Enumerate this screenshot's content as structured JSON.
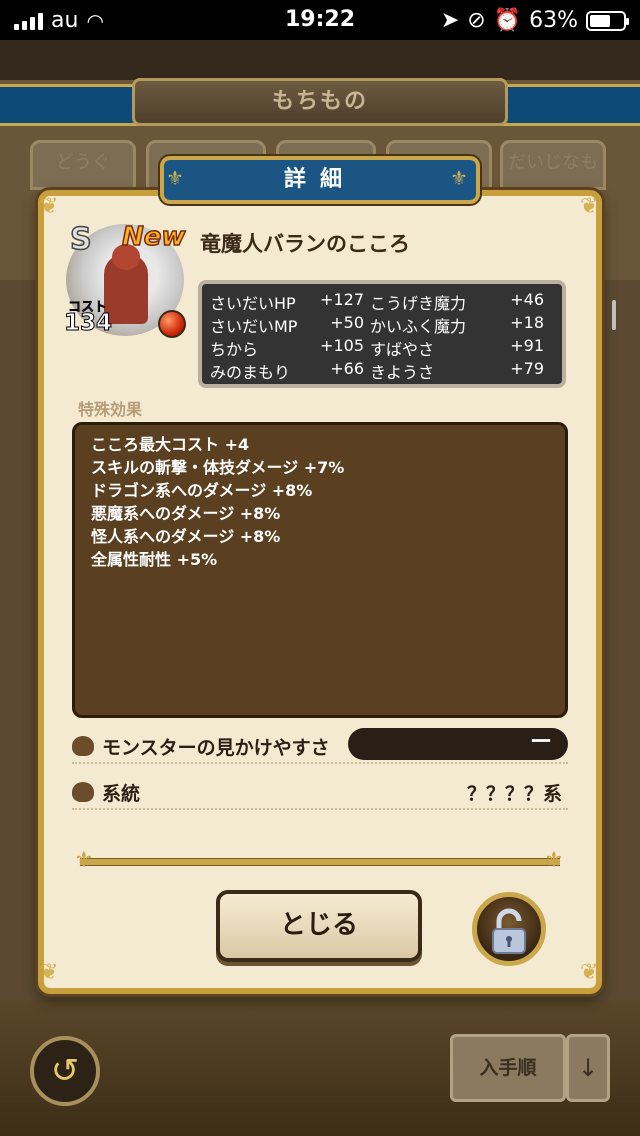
{
  "status_bar": {
    "carrier": "au",
    "time": "19:22",
    "battery": "63%",
    "battery_level": 0.63
  },
  "background": {
    "title": "もちもの",
    "tabs": [
      "どうぐ",
      "",
      "",
      "",
      "だいじなもの"
    ],
    "sort_label": "入手順",
    "sort_arrow": "↓",
    "back_icon": "↺"
  },
  "dialog": {
    "header": "詳細",
    "rank": "S",
    "new_badge": "New",
    "cost_label": "コスト",
    "cost_value": "134",
    "name": "竜魔人バランのこころ",
    "stats": [
      {
        "label": "さいだいHP",
        "value": "+127"
      },
      {
        "label": "こうげき魔力",
        "value": "+46"
      },
      {
        "label": "さいだいMP",
        "value": "+50"
      },
      {
        "label": "かいふく魔力",
        "value": "+18"
      },
      {
        "label": "ちから",
        "value": "+105"
      },
      {
        "label": "すばやさ",
        "value": "+91"
      },
      {
        "label": "みのまもり",
        "value": "+66"
      },
      {
        "label": "きようさ",
        "value": "+79"
      }
    ],
    "effects_label": "特殊効果",
    "effects": [
      "こころ最大コスト +4",
      "スキルの斬撃・体技ダメージ +7%",
      "ドラゴン系へのダメージ +8%",
      "悪魔系へのダメージ +8%",
      "怪人系へのダメージ +8%",
      "全属性耐性 +5%"
    ],
    "visibility_label": "モンスターの見かけやすさ",
    "visibility_value": "ー",
    "lineage_label": "系統",
    "lineage_value": "？？？？系",
    "close_label": "とじる"
  }
}
